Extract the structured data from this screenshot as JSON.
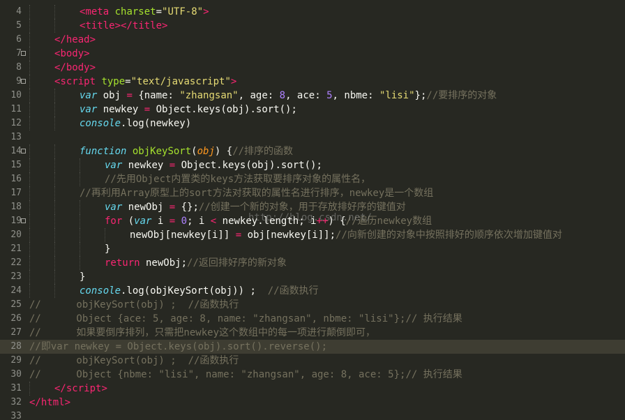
{
  "editor": {
    "theme": {
      "background": "#272822",
      "current_line": "#3e3d32",
      "keyword": "#f92672",
      "string": "#e6db74",
      "number": "#ae81ff",
      "function": "#a6e22e",
      "storage": "#66d9ef",
      "comment": "#75715e",
      "parameter": "#fd971f",
      "line_number": "#8f908a"
    },
    "current_line": 28,
    "watermark": "http://blog.csdn.net/",
    "lines": [
      {
        "n": "4",
        "fold": false,
        "indent": 2,
        "tokens": [
          [
            "tag",
            "<"
          ],
          [
            "tag",
            "meta"
          ],
          [
            "pl",
            " "
          ],
          [
            "attr",
            "charset"
          ],
          [
            "pl",
            "="
          ],
          [
            "str",
            "\"UTF-8\""
          ],
          [
            "tag",
            ">"
          ]
        ]
      },
      {
        "n": "5",
        "fold": false,
        "indent": 2,
        "tokens": [
          [
            "tag",
            "<"
          ],
          [
            "tag",
            "title"
          ],
          [
            "tag",
            "></"
          ],
          [
            "tag",
            "title"
          ],
          [
            "tag",
            ">"
          ]
        ]
      },
      {
        "n": "6",
        "fold": false,
        "indent": 1,
        "tokens": [
          [
            "tag",
            "</"
          ],
          [
            "tag",
            "head"
          ],
          [
            "tag",
            ">"
          ]
        ]
      },
      {
        "n": "7",
        "fold": true,
        "indent": 1,
        "tokens": [
          [
            "tag",
            "<"
          ],
          [
            "tag",
            "body"
          ],
          [
            "tag",
            ">"
          ]
        ]
      },
      {
        "n": "8",
        "fold": false,
        "indent": 1,
        "tokens": [
          [
            "tag",
            "</"
          ],
          [
            "tag",
            "body"
          ],
          [
            "tag",
            ">"
          ]
        ]
      },
      {
        "n": "9",
        "fold": true,
        "indent": 1,
        "tokens": [
          [
            "tag",
            "<"
          ],
          [
            "tag",
            "script"
          ],
          [
            "pl",
            " "
          ],
          [
            "attr",
            "type"
          ],
          [
            "pl",
            "="
          ],
          [
            "str",
            "\"text/javascript\""
          ],
          [
            "tag",
            ">"
          ]
        ]
      },
      {
        "n": "10",
        "fold": false,
        "indent": 2,
        "tokens": [
          [
            "kw",
            "var"
          ],
          [
            "pl",
            " obj "
          ],
          [
            "kw2",
            "="
          ],
          [
            "pl",
            " {name: "
          ],
          [
            "str",
            "\"zhangsan\""
          ],
          [
            "pl",
            ", age: "
          ],
          [
            "num",
            "8"
          ],
          [
            "pl",
            ", ace: "
          ],
          [
            "num",
            "5"
          ],
          [
            "pl",
            ", nbme: "
          ],
          [
            "str",
            "\"lisi\""
          ],
          [
            "pl",
            "};"
          ],
          [
            "com",
            "//要排序的对象"
          ]
        ]
      },
      {
        "n": "11",
        "fold": false,
        "indent": 2,
        "tokens": [
          [
            "kw",
            "var"
          ],
          [
            "pl",
            " newkey "
          ],
          [
            "kw2",
            "="
          ],
          [
            "pl",
            " Object.keys(obj).sort();"
          ]
        ]
      },
      {
        "n": "12",
        "fold": false,
        "indent": 2,
        "tokens": [
          [
            "kw",
            "console"
          ],
          [
            "pl",
            ".log(newkey)"
          ]
        ]
      },
      {
        "n": "13",
        "fold": false,
        "indent": 0,
        "tokens": []
      },
      {
        "n": "14",
        "fold": true,
        "indent": 2,
        "tokens": [
          [
            "kw",
            "function"
          ],
          [
            "pl",
            " "
          ],
          [
            "fn",
            "objKeySort"
          ],
          [
            "pl",
            "("
          ],
          [
            "par",
            "obj"
          ],
          [
            "pl",
            ") {"
          ],
          [
            "com",
            "//排序的函数"
          ]
        ]
      },
      {
        "n": "15",
        "fold": false,
        "indent": 3,
        "tokens": [
          [
            "kw",
            "var"
          ],
          [
            "pl",
            " newkey "
          ],
          [
            "kw2",
            "="
          ],
          [
            "pl",
            " Object.keys(obj).sort();"
          ]
        ]
      },
      {
        "n": "16",
        "fold": false,
        "indent": 3,
        "tokens": [
          [
            "com",
            "//先用Object内置类的keys方法获取要排序对象的属性名，"
          ]
        ]
      },
      {
        "n": "17",
        "fold": false,
        "indent": 2,
        "tokens": [
          [
            "com",
            "//再利用Array原型上的sort方法对获取的属性名进行排序，newkey是一个数组"
          ]
        ]
      },
      {
        "n": "18",
        "fold": false,
        "indent": 3,
        "tokens": [
          [
            "kw",
            "var"
          ],
          [
            "pl",
            " newObj "
          ],
          [
            "kw2",
            "="
          ],
          [
            "pl",
            " {};"
          ],
          [
            "com",
            "//创建一个新的对象，用于存放排好序的键值对"
          ]
        ]
      },
      {
        "n": "19",
        "fold": true,
        "indent": 3,
        "tokens": [
          [
            "kw2",
            "for"
          ],
          [
            "pl",
            " ("
          ],
          [
            "kw",
            "var"
          ],
          [
            "pl",
            " i "
          ],
          [
            "kw2",
            "="
          ],
          [
            "pl",
            " "
          ],
          [
            "num",
            "0"
          ],
          [
            "pl",
            "; i "
          ],
          [
            "kw2",
            "<"
          ],
          [
            "pl",
            " newkey.length; i"
          ],
          [
            "kw2",
            "++"
          ],
          [
            "pl",
            ") {"
          ],
          [
            "com",
            "//遍历newkey数组"
          ]
        ]
      },
      {
        "n": "20",
        "fold": false,
        "indent": 4,
        "tokens": [
          [
            "pl",
            "newObj[newkey[i]] "
          ],
          [
            "kw2",
            "="
          ],
          [
            "pl",
            " obj[newkey[i]];"
          ],
          [
            "com",
            "//向新创建的对象中按照排好的顺序依次增加键值对"
          ]
        ]
      },
      {
        "n": "21",
        "fold": false,
        "indent": 3,
        "tokens": [
          [
            "pl",
            "}"
          ]
        ]
      },
      {
        "n": "22",
        "fold": false,
        "indent": 3,
        "tokens": [
          [
            "kw2",
            "return"
          ],
          [
            "pl",
            " newObj;"
          ],
          [
            "com",
            "//返回排好序的新对象"
          ]
        ]
      },
      {
        "n": "23",
        "fold": false,
        "indent": 2,
        "tokens": [
          [
            "pl",
            "}"
          ]
        ]
      },
      {
        "n": "24",
        "fold": false,
        "indent": 2,
        "tokens": [
          [
            "kw",
            "console"
          ],
          [
            "pl",
            ".log(objKeySort(obj)) ;  "
          ],
          [
            "com",
            "//函数执行"
          ]
        ]
      },
      {
        "n": "25",
        "fold": false,
        "indent": 0,
        "tokens": [
          [
            "com",
            "//      objKeySort(obj) ;  //函数执行"
          ]
        ]
      },
      {
        "n": "26",
        "fold": false,
        "indent": 0,
        "tokens": [
          [
            "com",
            "//      Object {ace: 5, age: 8, name: \"zhangsan\", nbme: \"lisi\"};// 执行结果"
          ]
        ]
      },
      {
        "n": "27",
        "fold": false,
        "indent": 0,
        "tokens": [
          [
            "com",
            "//      如果要倒序排列，只需把newkey这个数组中的每一项进行颠倒即可，"
          ]
        ]
      },
      {
        "n": "28",
        "fold": false,
        "indent": 0,
        "tokens": [
          [
            "com",
            "//即var newkey = Object.keys(obj).sort().reverse();"
          ]
        ]
      },
      {
        "n": "29",
        "fold": false,
        "indent": 0,
        "tokens": [
          [
            "com",
            "//      objKeySort(obj) ;  //函数执行"
          ]
        ]
      },
      {
        "n": "30",
        "fold": false,
        "indent": 0,
        "tokens": [
          [
            "com",
            "//      Object {nbme: \"lisi\", name: \"zhangsan\", age: 8, ace: 5};// 执行结果"
          ]
        ]
      },
      {
        "n": "31",
        "fold": false,
        "indent": 1,
        "tokens": [
          [
            "tag",
            "</"
          ],
          [
            "tag",
            "script"
          ],
          [
            "tag",
            ">"
          ]
        ]
      },
      {
        "n": "32",
        "fold": false,
        "indent": 0,
        "tokens": [
          [
            "tag",
            "</"
          ],
          [
            "tag",
            "html"
          ],
          [
            "tag",
            ">"
          ]
        ]
      },
      {
        "n": "33",
        "fold": false,
        "indent": 0,
        "tokens": []
      }
    ]
  }
}
